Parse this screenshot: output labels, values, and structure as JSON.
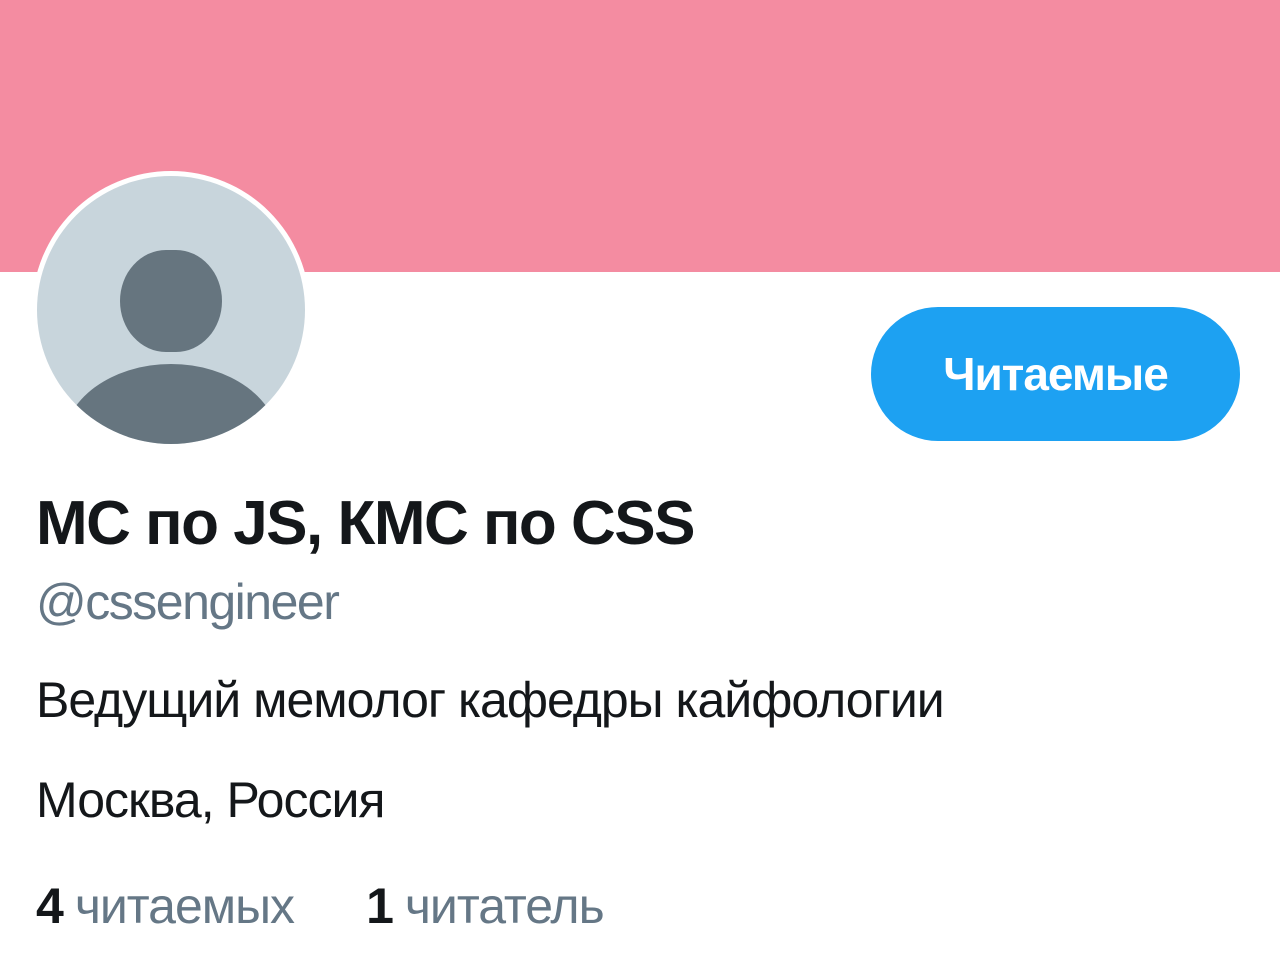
{
  "profile": {
    "banner_color": "#f48ca1",
    "avatar_icon": "default-user-silhouette-icon",
    "follow_button_label": "Читаемые",
    "follow_button_color": "#1da1f2",
    "display_name": "МС по JS, КМС по CSS",
    "handle": "@cssengineer",
    "bio": "Ведущий мемолог кафедры кайфологии",
    "location": "Москва, Россия",
    "stats": [
      {
        "count": "4",
        "label": "читаемых"
      },
      {
        "count": "1",
        "label": "читатель"
      }
    ]
  }
}
